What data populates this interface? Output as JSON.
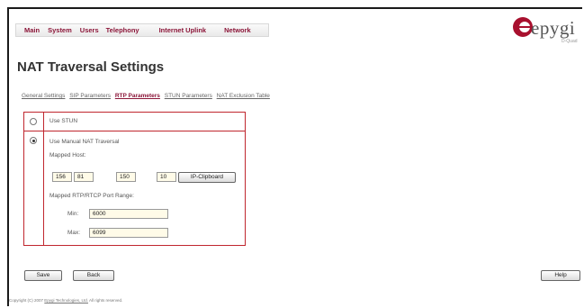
{
  "nav": {
    "items": [
      "Main",
      "System",
      "Users",
      "Telephony",
      "Internet Uplink",
      "Network"
    ]
  },
  "logo": {
    "brand": "epygi",
    "sub": "D-Quad"
  },
  "page": {
    "title": "NAT Traversal Settings"
  },
  "tabs": {
    "items": [
      "General Settings",
      "SIP Parameters",
      "RTP Parameters",
      "STUN Parameters",
      "NAT Exclusion Table"
    ],
    "active": "RTP Parameters"
  },
  "options": {
    "use_stun": {
      "label": "Use STUN",
      "selected": false
    },
    "manual_nat": {
      "label": "Use Manual NAT Traversal",
      "selected": true,
      "mapped_host_label": "Mapped Host:",
      "mapped_host": [
        "156",
        "81",
        "150",
        "10"
      ],
      "clipboard_button": "IP-Clipboard",
      "port_range_label": "Mapped RTP/RTCP Port Range:",
      "min_label": "Min:",
      "min_value": "6000",
      "max_label": "Max:",
      "max_value": "6099"
    }
  },
  "actions": {
    "save": "Save",
    "back": "Back",
    "help": "Help"
  },
  "footer": {
    "prefix": "Copyright (C) 2007",
    "company": "Epygi Technologies, Ltd.",
    "suffix": "All rights reserved."
  },
  "colors": {
    "accent": "#8b1538",
    "border": "#c0262e"
  }
}
